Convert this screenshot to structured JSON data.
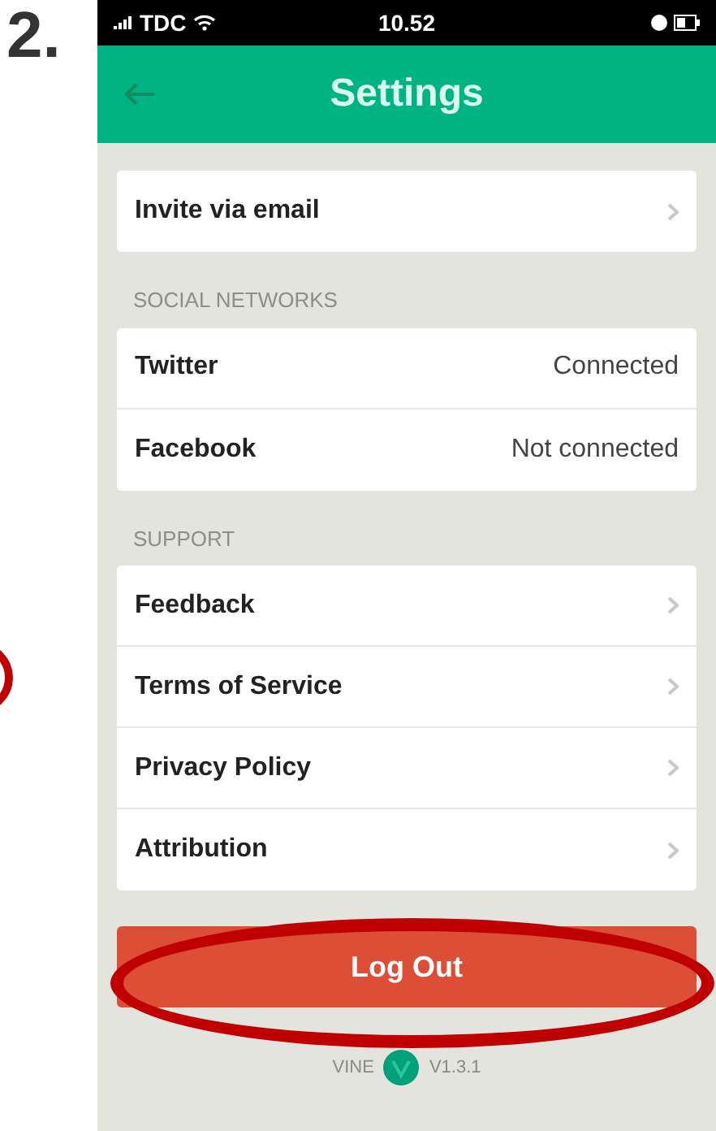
{
  "step_label": "2.",
  "status_bar": {
    "carrier": "TDC",
    "time": "10.52"
  },
  "header": {
    "title": "Settings"
  },
  "sections": [
    {
      "items": [
        {
          "label": "Invite via email",
          "kind": "chevron"
        }
      ]
    },
    {
      "heading": "SOCIAL NETWORKS",
      "items": [
        {
          "label": "Twitter",
          "kind": "value",
          "value": "Connected"
        },
        {
          "label": "Facebook",
          "kind": "value",
          "value": "Not connected"
        }
      ]
    },
    {
      "heading": "SUPPORT",
      "items": [
        {
          "label": "Feedback",
          "kind": "chevron"
        },
        {
          "label": "Terms of Service",
          "kind": "chevron"
        },
        {
          "label": "Privacy Policy",
          "kind": "chevron"
        },
        {
          "label": "Attribution",
          "kind": "chevron"
        }
      ]
    }
  ],
  "logout_button": "Log Out",
  "footer": {
    "brand": "VINE",
    "version": "V1.3.1"
  }
}
